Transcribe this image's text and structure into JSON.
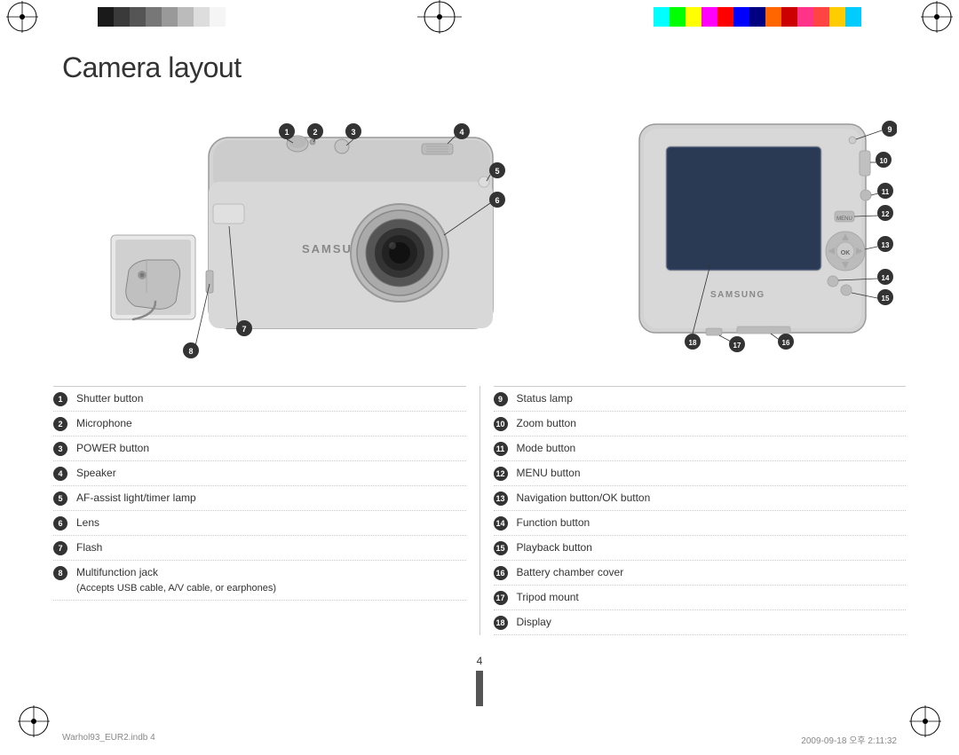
{
  "page": {
    "title": "Camera layout",
    "page_number": "4",
    "footer_left": "Warhol93_EUR2.indb   4",
    "footer_right": "2009-09-18   오후 2:11:32"
  },
  "colors_left": [
    "#1a1a1a",
    "#333",
    "#555",
    "#777",
    "#999",
    "#bbb",
    "#ddd",
    "#fff"
  ],
  "colors_right": [
    "#00ffff",
    "#00ff00",
    "#ffff00",
    "#ff00ff",
    "#ff0000",
    "#0000ff",
    "#ff6600",
    "#ff0000",
    "#cc0000",
    "#ff69b4",
    "#ff4444",
    "#ffcc00",
    "#00ccff",
    "#ffffff"
  ],
  "parts": {
    "left_column": [
      {
        "num": "1",
        "label": "Shutter button"
      },
      {
        "num": "2",
        "label": "Microphone"
      },
      {
        "num": "3",
        "label": "POWER button"
      },
      {
        "num": "4",
        "label": "Speaker"
      },
      {
        "num": "5",
        "label": "AF-assist light/timer lamp"
      },
      {
        "num": "6",
        "label": "Lens"
      },
      {
        "num": "7",
        "label": "Flash"
      },
      {
        "num": "8",
        "label": "Multifunction jack\n(Accepts USB cable, A/V cable, or earphones)"
      }
    ],
    "right_column": [
      {
        "num": "9",
        "label": "Status lamp"
      },
      {
        "num": "10",
        "label": "Zoom button"
      },
      {
        "num": "11",
        "label": "Mode button"
      },
      {
        "num": "12",
        "label": "MENU button"
      },
      {
        "num": "13",
        "label": "Navigation button/OK button"
      },
      {
        "num": "14",
        "label": "Function button"
      },
      {
        "num": "15",
        "label": "Playback button"
      },
      {
        "num": "16",
        "label": "Battery chamber cover"
      },
      {
        "num": "17",
        "label": "Tripod mount"
      },
      {
        "num": "18",
        "label": "Display"
      }
    ]
  }
}
